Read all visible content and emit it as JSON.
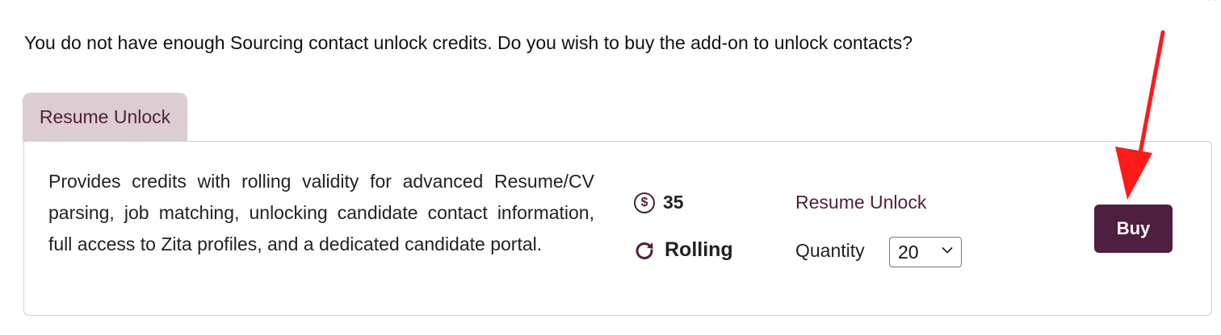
{
  "dialog": {
    "close_glyph": "×",
    "prompt_text": "You do not have enough Sourcing contact unlock credits. Do you wish to buy the add-on to unlock contacts?"
  },
  "addon": {
    "tab_label": "Resume Unlock",
    "description": "Provides credits with rolling validity for advanced Resume/CV parsing, job matching, unlocking candidate contact information, full access to Zita profiles, and a dedicated candidate portal.",
    "price_icon": "dollar-circle-icon",
    "price": "35",
    "validity_icon": "rolling-refresh-icon",
    "validity": "Rolling",
    "plan_name": "Resume Unlock",
    "quantity_label": "Quantity",
    "quantity_value": "20",
    "buy_label": "Buy"
  },
  "colors": {
    "brand": "#4f1f3f",
    "tab_bg": "#dccdd3",
    "annotation_arrow": "#ff1a1a"
  }
}
